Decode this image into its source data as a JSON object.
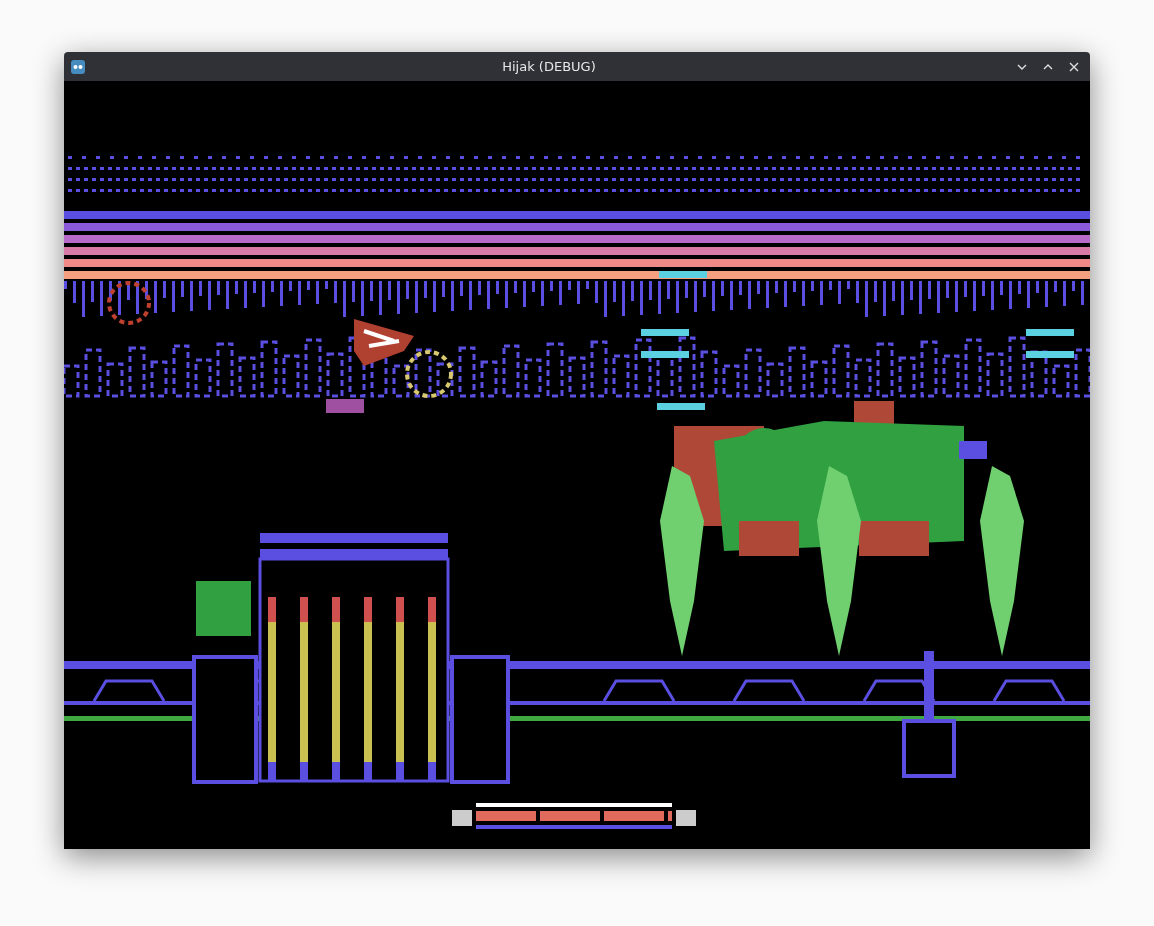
{
  "window": {
    "title": "Hijak (DEBUG)"
  },
  "hud": {
    "health": {
      "level": 1
    }
  }
}
